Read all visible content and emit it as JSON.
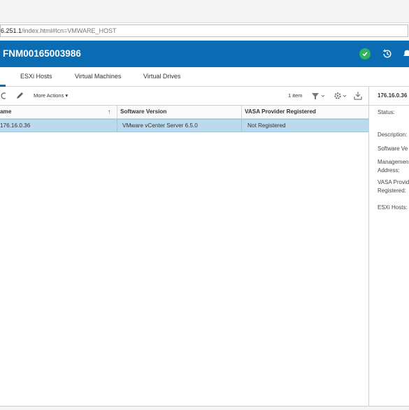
{
  "browser": {
    "url_host": "6.251.1",
    "url_path": "/index.html#lcn=VMWARE_HOST"
  },
  "header": {
    "title": "FNM00165003986",
    "status_icon": "check-circle-icon",
    "status_color": "#30b35c",
    "accent": "#0a6cb3"
  },
  "tabs": [
    "ESXi Hosts",
    "Virtual Machines",
    "Virtual Drives"
  ],
  "toolbar": {
    "more_actions": "More Actions ▾",
    "item_count": "1 item"
  },
  "table": {
    "columns": [
      "ame",
      "Software Version",
      "VASA Provider Registered"
    ],
    "rows": [
      [
        "176.16.0.36",
        "VMware vCenter Server 6.5.0",
        "Not Registered"
      ]
    ]
  },
  "details": {
    "title": "176.16.0.36",
    "labels": [
      "Status:",
      "Description:",
      "Software Ve",
      "Managemen",
      "Address:",
      "VASA Provid",
      "Registered:",
      "ESXi Hosts:"
    ]
  }
}
